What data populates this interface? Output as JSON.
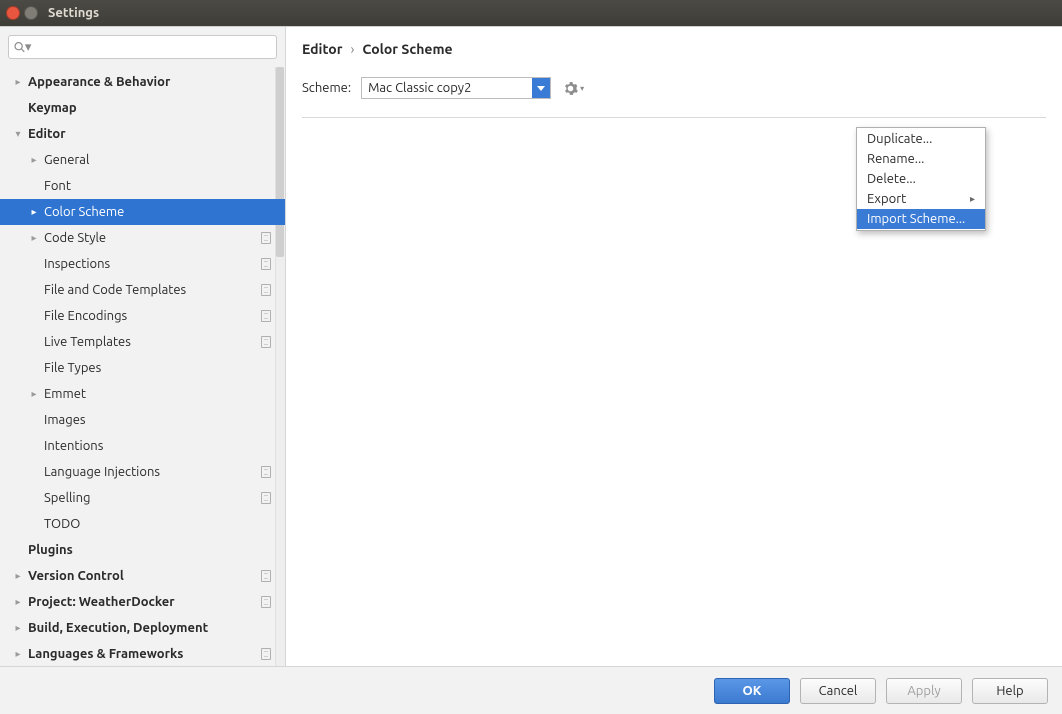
{
  "window": {
    "title": "Settings"
  },
  "search": {
    "placeholder": ""
  },
  "tree": [
    {
      "label": "Appearance & Behavior",
      "level": 0,
      "bold": true,
      "arrow": "right"
    },
    {
      "label": "Keymap",
      "level": 0,
      "bold": true,
      "arrow": "none"
    },
    {
      "label": "Editor",
      "level": 0,
      "bold": true,
      "arrow": "down"
    },
    {
      "label": "General",
      "level": 1,
      "arrow": "right"
    },
    {
      "label": "Font",
      "level": 1,
      "arrow": "none"
    },
    {
      "label": "Color Scheme",
      "level": 1,
      "arrow": "right",
      "selected": true
    },
    {
      "label": "Code Style",
      "level": 1,
      "arrow": "right",
      "icon": true
    },
    {
      "label": "Inspections",
      "level": 1,
      "arrow": "none",
      "icon": true
    },
    {
      "label": "File and Code Templates",
      "level": 1,
      "arrow": "none",
      "icon": true
    },
    {
      "label": "File Encodings",
      "level": 1,
      "arrow": "none",
      "icon": true
    },
    {
      "label": "Live Templates",
      "level": 1,
      "arrow": "none",
      "icon": true
    },
    {
      "label": "File Types",
      "level": 1,
      "arrow": "none"
    },
    {
      "label": "Emmet",
      "level": 1,
      "arrow": "right"
    },
    {
      "label": "Images",
      "level": 1,
      "arrow": "none"
    },
    {
      "label": "Intentions",
      "level": 1,
      "arrow": "none"
    },
    {
      "label": "Language Injections",
      "level": 1,
      "arrow": "none",
      "icon": true
    },
    {
      "label": "Spelling",
      "level": 1,
      "arrow": "none",
      "icon": true
    },
    {
      "label": "TODO",
      "level": 1,
      "arrow": "none"
    },
    {
      "label": "Plugins",
      "level": 0,
      "bold": true,
      "arrow": "none"
    },
    {
      "label": "Version Control",
      "level": 0,
      "bold": true,
      "arrow": "right",
      "icon": true
    },
    {
      "label": "Project: WeatherDocker",
      "level": 0,
      "bold": true,
      "arrow": "right",
      "icon": true
    },
    {
      "label": "Build, Execution, Deployment",
      "level": 0,
      "bold": true,
      "arrow": "right"
    },
    {
      "label": "Languages & Frameworks",
      "level": 0,
      "bold": true,
      "arrow": "right",
      "icon": true
    }
  ],
  "breadcrumb": {
    "parent": "Editor",
    "current": "Color Scheme",
    "sep": "›"
  },
  "scheme": {
    "label": "Scheme:",
    "selected": "Mac Classic copy2"
  },
  "menu": [
    {
      "label": "Duplicate...",
      "submenu": false
    },
    {
      "label": "Rename...",
      "submenu": false
    },
    {
      "label": "Delete...",
      "submenu": false
    },
    {
      "label": "Export",
      "submenu": true
    },
    {
      "label": "Import Scheme...",
      "submenu": false,
      "hover": true
    }
  ],
  "buttons": {
    "ok": "OK",
    "cancel": "Cancel",
    "apply": "Apply",
    "help": "Help"
  }
}
